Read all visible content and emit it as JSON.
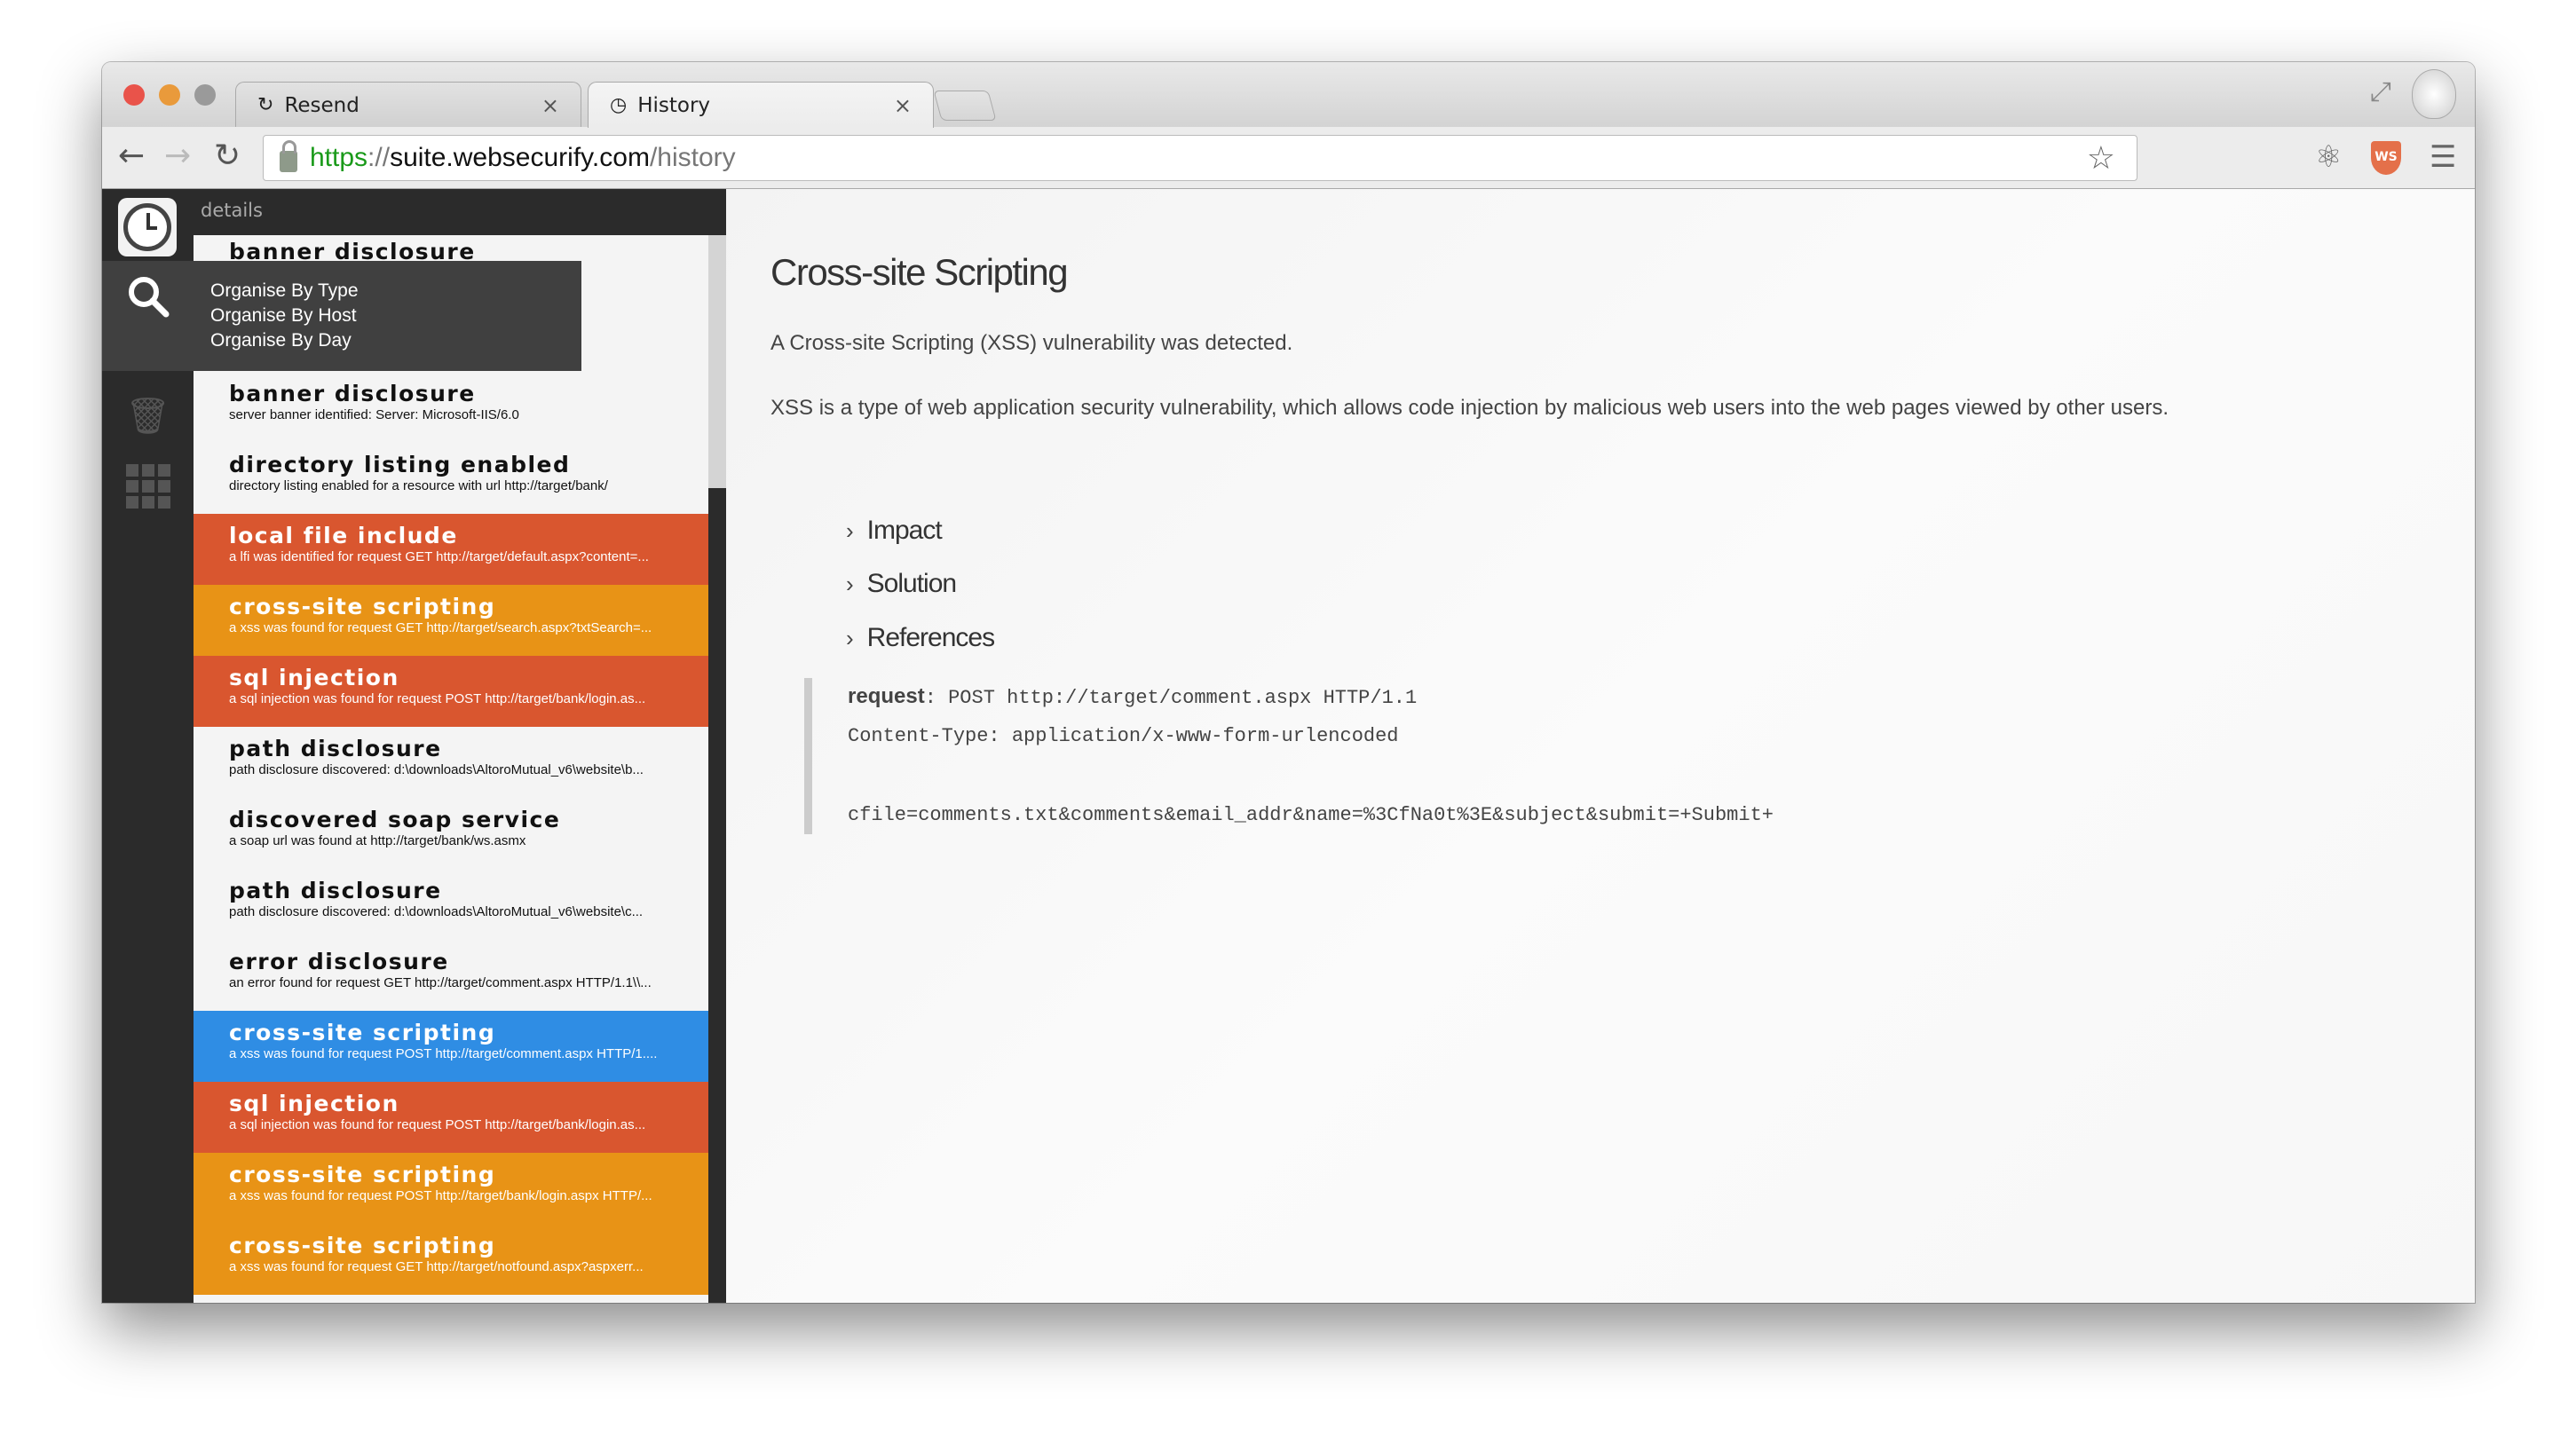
{
  "browser": {
    "tabs": [
      {
        "label": "Resend",
        "icon": "reload-icon",
        "active": false
      },
      {
        "label": "History",
        "icon": "clock-icon",
        "active": true
      }
    ],
    "close_glyph": "×",
    "url": {
      "scheme": "https",
      "sep": "://",
      "host": "suite.websecurify.com",
      "path": "/history"
    },
    "extension_badge": "WS"
  },
  "sidebar": {
    "header": "details",
    "menu": [
      "Organise By Type",
      "Organise By Host",
      "Organise By Day"
    ],
    "items": [
      {
        "title": "banner disclosure",
        "desc": "",
        "color": "none"
      },
      {
        "title": "banner disclosure",
        "desc": "server banner identified: Server: Microsoft-IIS/6.0",
        "color": "none"
      },
      {
        "title": "directory listing enabled",
        "desc": "directory listing enabled for a resource with url http://target/bank/",
        "color": "none"
      },
      {
        "title": "local file include",
        "desc": "a lfi was identified for request GET http://target/default.aspx?content=...",
        "color": "red"
      },
      {
        "title": "cross-site scripting",
        "desc": "a xss was found for request GET http://target/search.aspx?txtSearch=...",
        "color": "orange"
      },
      {
        "title": "sql injection",
        "desc": "a sql injection was found for request POST http://target/bank/login.as...",
        "color": "red"
      },
      {
        "title": "path disclosure",
        "desc": "path disclosure discovered: d:\\downloads\\AltoroMutual_v6\\website\\b...",
        "color": "none"
      },
      {
        "title": "discovered soap service",
        "desc": "a soap url was found at http://target/bank/ws.asmx",
        "color": "none"
      },
      {
        "title": "path disclosure",
        "desc": "path disclosure discovered: d:\\downloads\\AltoroMutual_v6\\website\\c...",
        "color": "none"
      },
      {
        "title": "error disclosure",
        "desc": "an error found for request GET http://target/comment.aspx HTTP/1.1\\\\...",
        "color": "none"
      },
      {
        "title": "cross-site scripting",
        "desc": "a xss was found for request POST http://target/comment.aspx HTTP/1....",
        "color": "blue"
      },
      {
        "title": "sql injection",
        "desc": "a sql injection was found for request POST http://target/bank/login.as...",
        "color": "red"
      },
      {
        "title": "cross-site scripting",
        "desc": "a xss was found for request POST http://target/bank/login.aspx HTTP/...",
        "color": "orange"
      },
      {
        "title": "cross-site scripting",
        "desc": "a xss was found for request GET http://target/notfound.aspx?aspxerr...",
        "color": "orange"
      }
    ]
  },
  "detail": {
    "title": "Cross-site Scripting",
    "summary": "A Cross-site Scripting (XSS) vulnerability was detected.",
    "description": "XSS is a type of web application security vulnerability, which allows code injection by malicious web users into the web pages viewed by other users.",
    "sections": [
      "Impact",
      "Solution",
      "References"
    ],
    "request_label": "request",
    "request_line": "POST http://target/comment.aspx HTTP/1.1",
    "header_line": "Content-Type: application/x-www-form-urlencoded",
    "body_line": "cfile=comments.txt&comments&email_addr&name=%3CfNa0t%3E&subject&submit=+Submit+"
  },
  "colors": {
    "red": "#d9562f",
    "orange": "#e89316",
    "blue": "#2f8de4",
    "rail": "#2b2b2b"
  }
}
